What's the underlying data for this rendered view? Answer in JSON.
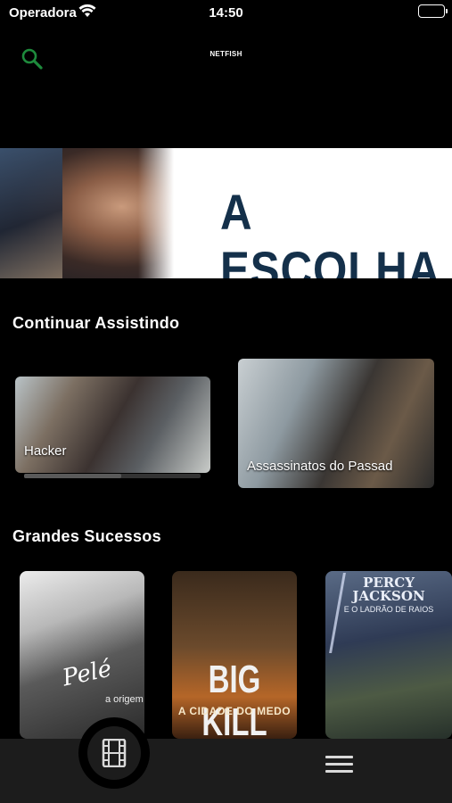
{
  "status_bar": {
    "carrier": "Operadora",
    "time": "14:50",
    "battery_level": 1.0
  },
  "header": {
    "logo": "NETFISH",
    "search_icon": "search-icon",
    "accent_color": "#1e8a3c"
  },
  "hero": {
    "title": "A ESCOLHA",
    "title_color": "#14304a"
  },
  "continue_watching": {
    "title": "Continuar Assistindo",
    "items": [
      {
        "label": "Hacker",
        "progress": 0.55
      },
      {
        "label": "Assassinatos do Passad"
      }
    ]
  },
  "top_hits": {
    "title": "Grandes Sucessos",
    "items": [
      {
        "title": "Pelé",
        "subtitle": "a origem"
      },
      {
        "title": "BIG KILL",
        "subtitle": "A CIDADE DO MEDO"
      },
      {
        "title": "PERCY JACKSON",
        "subtitle": "E O LADRÃO DE RAIOS"
      }
    ]
  },
  "tab_bar": {
    "movies_icon": "film-icon",
    "menu_icon": "hamburger-menu-icon"
  }
}
